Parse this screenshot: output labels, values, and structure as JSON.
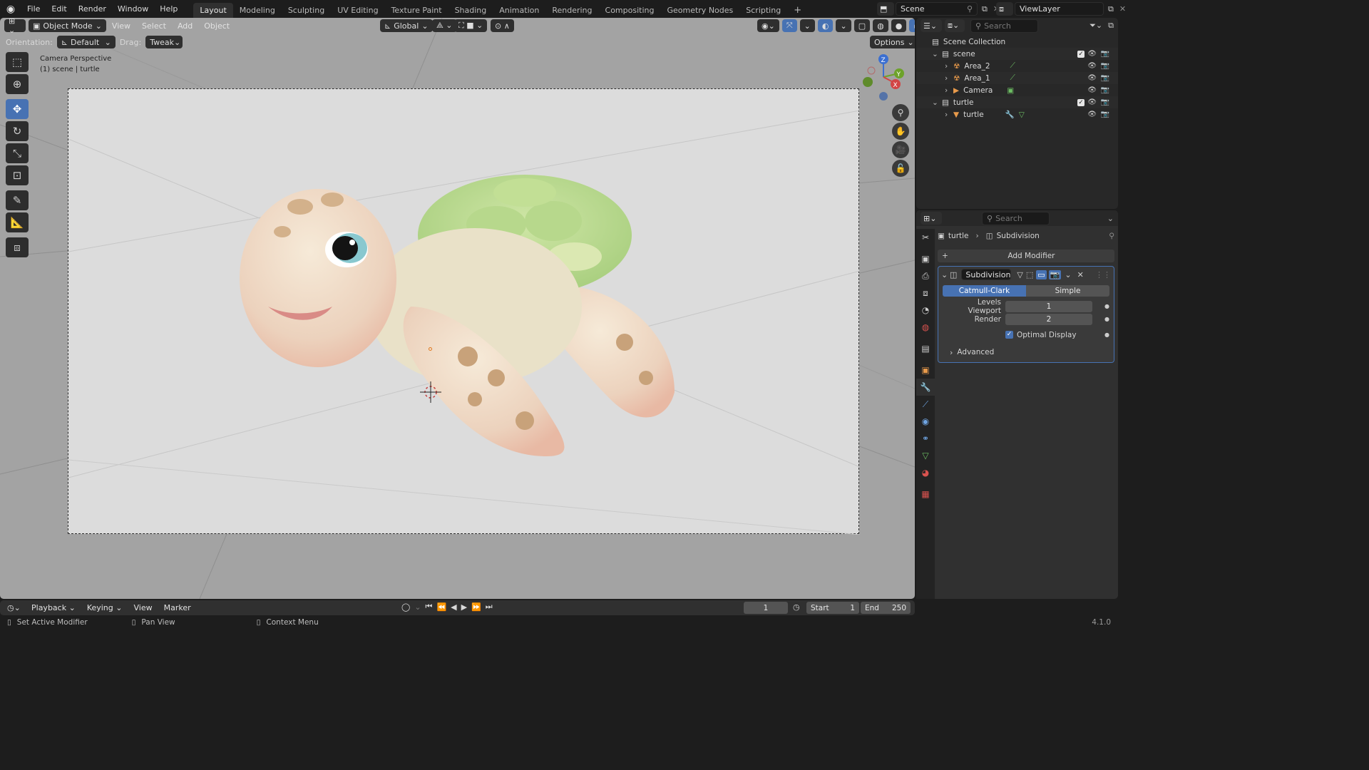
{
  "menubar": {
    "items": [
      "File",
      "Edit",
      "Render",
      "Window",
      "Help"
    ],
    "workspaces": [
      "Layout",
      "Modeling",
      "Sculpting",
      "UV Editing",
      "Texture Paint",
      "Shading",
      "Animation",
      "Rendering",
      "Compositing",
      "Geometry Nodes",
      "Scripting"
    ],
    "active_workspace": "Layout",
    "add_tab": "+",
    "scene_name": "Scene",
    "view_layer": "ViewLayer"
  },
  "viewport": {
    "mode": "Object Mode",
    "menus": [
      "View",
      "Select",
      "Add",
      "Object"
    ],
    "transform_orientation": "Global",
    "orientation_label": "Orientation:",
    "orientation_value": "Default",
    "drag_label": "Drag:",
    "drag_value": "Tweak",
    "options_label": "Options",
    "overlay_title": "Camera Perspective",
    "overlay_subtitle": "(1) scene | turtle",
    "gizmo_axes": [
      "Z",
      "Y",
      "X"
    ],
    "tools": [
      "select-box-icon",
      "cursor-icon",
      "move-icon",
      "rotate-icon",
      "scale-icon",
      "transform-icon",
      "annotate-icon",
      "measure-icon",
      "add-cube-icon"
    ],
    "active_tool": "move-icon"
  },
  "outliner": {
    "search_placeholder": "Search",
    "root": "Scene Collection",
    "rows": [
      {
        "label": "scene",
        "indent": 1,
        "type": "collection",
        "expanded": true
      },
      {
        "label": "Area_2",
        "indent": 2,
        "type": "light"
      },
      {
        "label": "Area_1",
        "indent": 2,
        "type": "light"
      },
      {
        "label": "Camera",
        "indent": 2,
        "type": "camera"
      },
      {
        "label": "turtle",
        "indent": 1,
        "type": "collection",
        "expanded": true
      },
      {
        "label": "turtle",
        "indent": 2,
        "type": "mesh"
      }
    ]
  },
  "properties": {
    "search_placeholder": "Search",
    "breadcrumb_object": "turtle",
    "breadcrumb_modifier": "Subdivision",
    "add_modifier": "Add Modifier",
    "modifier_name": "Subdivision",
    "algorithm_options": [
      "Catmull-Clark",
      "Simple"
    ],
    "algorithm_selected": "Catmull-Clark",
    "levels_viewport_label": "Levels Viewport",
    "levels_viewport": "1",
    "render_label": "Render",
    "render_levels": "2",
    "optimal_display_label": "Optimal Display",
    "optimal_display": true,
    "advanced_label": "Advanced"
  },
  "timeline": {
    "menus": [
      "Playback",
      "Keying",
      "View",
      "Marker"
    ],
    "current_frame": "1",
    "start_label": "Start",
    "start": "1",
    "end_label": "End",
    "end": "250"
  },
  "status": {
    "hints": [
      "Set Active Modifier",
      "Pan View",
      "Context Menu"
    ],
    "version": "4.1.0"
  },
  "colors": {
    "accent": "#4772b3",
    "background": "#1d1d1d",
    "panel": "#303030",
    "viewport_bg": "#a3a3a3"
  }
}
